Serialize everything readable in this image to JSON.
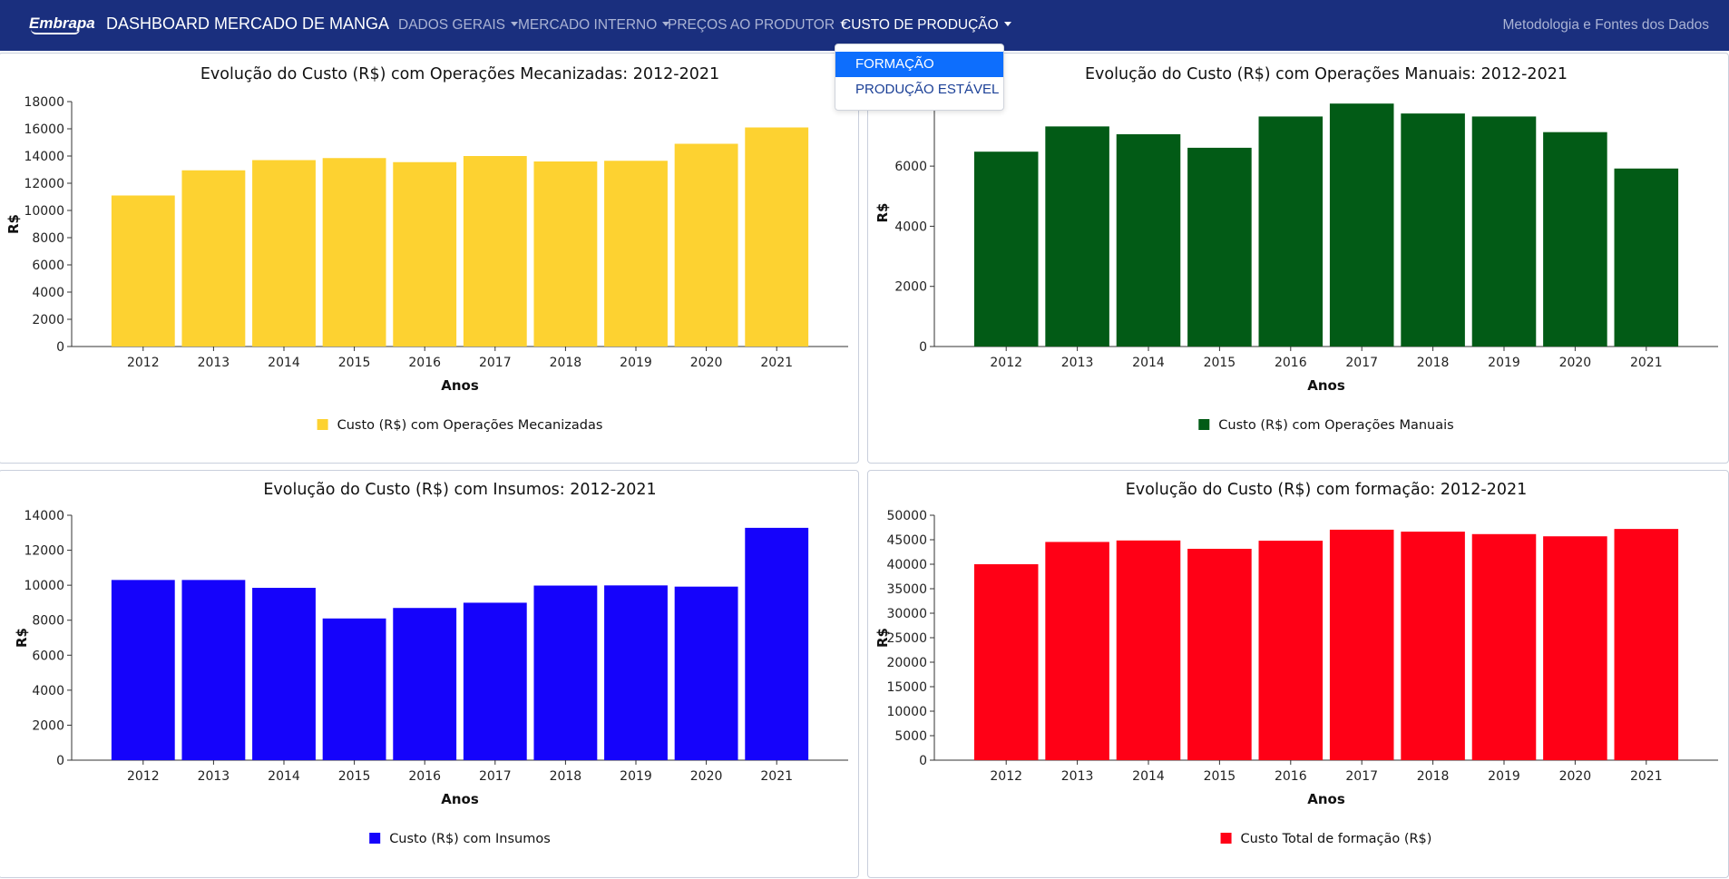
{
  "navbar": {
    "logo_text": "Embrapa",
    "brand": "DASHBOARD MERCADO DE MANGA",
    "menu": [
      {
        "label": "DADOS GERAIS"
      },
      {
        "label": "MERCADO INTERNO"
      },
      {
        "label": "PREÇOS AO PRODUTOR"
      },
      {
        "label": "CUSTO DE PRODUÇÃO"
      }
    ],
    "right_link": "Metodologia e Fontes dos Dados"
  },
  "dropdown": {
    "items": [
      {
        "label": "FORMAÇÃO",
        "selected": true
      },
      {
        "label": "PRODUÇÃO ESTÁVEL",
        "selected": false
      }
    ]
  },
  "chart_data": [
    {
      "type": "bar",
      "title": "Evolução do Custo (R$) com Operações Mecanizadas: 2012-2021",
      "xlabel": "Anos",
      "ylabel": "R$",
      "categories": [
        "2012",
        "2013",
        "2014",
        "2015",
        "2016",
        "2017",
        "2018",
        "2019",
        "2020",
        "2021"
      ],
      "series": [
        {
          "name": "Custo (R$) com Operações Mecanizadas",
          "color": "#fdd231",
          "values": [
            11100,
            12950,
            13700,
            13850,
            13550,
            14000,
            13600,
            13650,
            14900,
            16100
          ]
        }
      ],
      "yticks": [
        0,
        2000,
        4000,
        6000,
        8000,
        10000,
        12000,
        14000,
        16000,
        18000
      ],
      "ylim": [
        0,
        18000
      ],
      "legend_position": "bottom"
    },
    {
      "type": "bar",
      "title": "Evolução do Custo (R$) com Operações Manuais: 2012-2021",
      "xlabel": "Anos",
      "ylabel": "R$",
      "categories": [
        "2012",
        "2013",
        "2014",
        "2015",
        "2016",
        "2017",
        "2018",
        "2019",
        "2020",
        "2021"
      ],
      "series": [
        {
          "name": "Custo (R$) com Operações Manuais",
          "color": "#025b16",
          "values": [
            6480,
            7320,
            7060,
            6610,
            7650,
            8080,
            7750,
            7650,
            7130,
            5920
          ]
        }
      ],
      "yticks": [
        0,
        2000,
        4000,
        6000,
        8000
      ],
      "ylim": [
        0,
        8900
      ],
      "legend_position": "bottom"
    },
    {
      "type": "bar",
      "title": "Evolução do Custo (R$) com Insumos: 2012-2021",
      "xlabel": "Anos",
      "ylabel": "R$",
      "categories": [
        "2012",
        "2013",
        "2014",
        "2015",
        "2016",
        "2017",
        "2018",
        "2019",
        "2020",
        "2021"
      ],
      "series": [
        {
          "name": "Custo (R$) com Insumos",
          "color": "#1503fb",
          "values": [
            10300,
            10300,
            9850,
            8100,
            8700,
            9000,
            9980,
            9990,
            9920,
            13280
          ]
        }
      ],
      "yticks": [
        0,
        2000,
        4000,
        6000,
        8000,
        10000,
        12000,
        14000
      ],
      "ylim": [
        0,
        14000
      ],
      "legend_position": "bottom"
    },
    {
      "type": "bar",
      "title": "Evolução do Custo (R$) com formação: 2012-2021",
      "xlabel": "Anos",
      "ylabel": "R$",
      "categories": [
        "2012",
        "2013",
        "2014",
        "2015",
        "2016",
        "2017",
        "2018",
        "2019",
        "2020",
        "2021"
      ],
      "series": [
        {
          "name": "Custo Total de formação (R$)",
          "color": "#ff0016",
          "values": [
            40000,
            44550,
            44850,
            43150,
            44800,
            47050,
            46650,
            46150,
            45700,
            47200
          ]
        }
      ],
      "yticks": [
        0,
        5000,
        10000,
        15000,
        20000,
        25000,
        30000,
        35000,
        40000,
        45000,
        50000
      ],
      "ylim": [
        0,
        50000
      ],
      "legend_position": "bottom"
    }
  ]
}
